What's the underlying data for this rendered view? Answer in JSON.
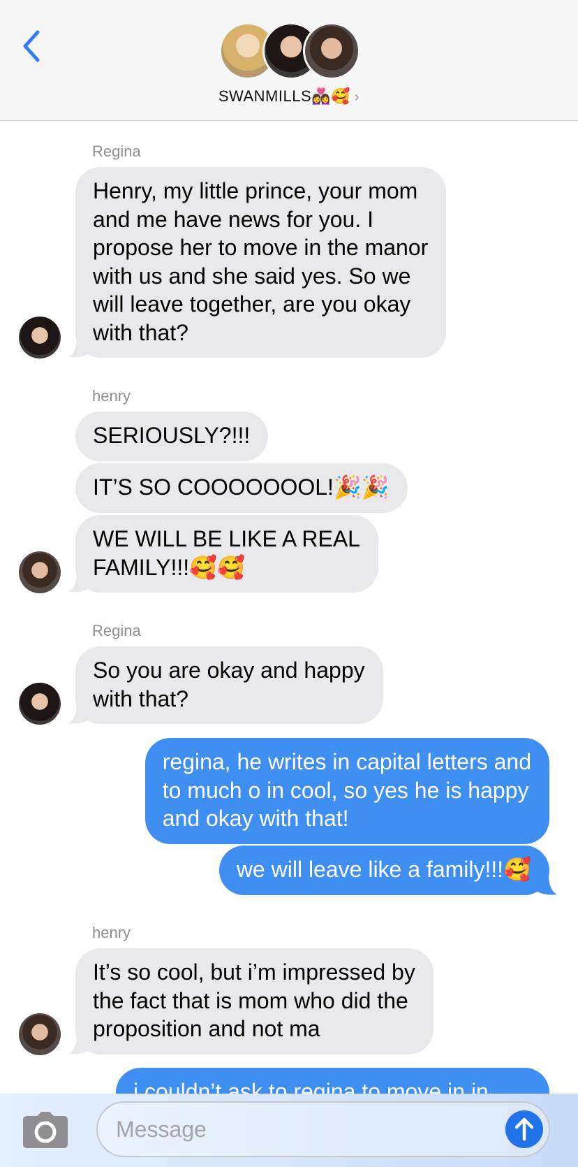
{
  "header": {
    "group_name": "SWANMILLS👩‍❤️‍👩🥰",
    "members": [
      {
        "name": "emma-avatar",
        "color": "#d9b76f"
      },
      {
        "name": "regina-avatar",
        "color": "#3a2b29"
      },
      {
        "name": "henry-avatar",
        "color": "#4b3a33"
      }
    ]
  },
  "messages": [
    {
      "sender": "Regina",
      "lines": [
        "Henry, my little prince, your mom",
        "and me have news for you. I",
        "propose her to move in the manor",
        "with us and she said yes. So we",
        "will leave together, are you okay",
        "with that?"
      ]
    },
    {
      "sender": "henry",
      "lines": [
        "SERIOUSLY?!!!"
      ]
    },
    {
      "lines": [
        "IT’S SO COOOOOOOL!🎉🎉"
      ]
    },
    {
      "lines": [
        "WE WILL BE LIKE A REAL",
        "FAMILY!!!🥰🥰"
      ]
    },
    {
      "sender": "Regina",
      "lines": [
        "So you are okay and happy",
        "with that?"
      ]
    },
    {
      "lines": [
        "regina, he writes in capital letters and",
        "to much o in cool, so yes he is happy",
        "and okay with that!"
      ]
    },
    {
      "lines": [
        "we will leave like a family!!!🥰"
      ]
    },
    {
      "sender": "henry",
      "lines": [
        "It’s so cool, but i’m impressed by",
        "the fact that is mom who did the",
        "proposition and not ma"
      ]
    },
    {
      "lines": [
        "i couldn’t ask to regina to move in in"
      ]
    }
  ],
  "input": {
    "placeholder": "Message"
  },
  "colors": {
    "accent": "#3f8ef2",
    "incoming": "#e9e9eb",
    "header_bg": "#f7f7f7"
  }
}
